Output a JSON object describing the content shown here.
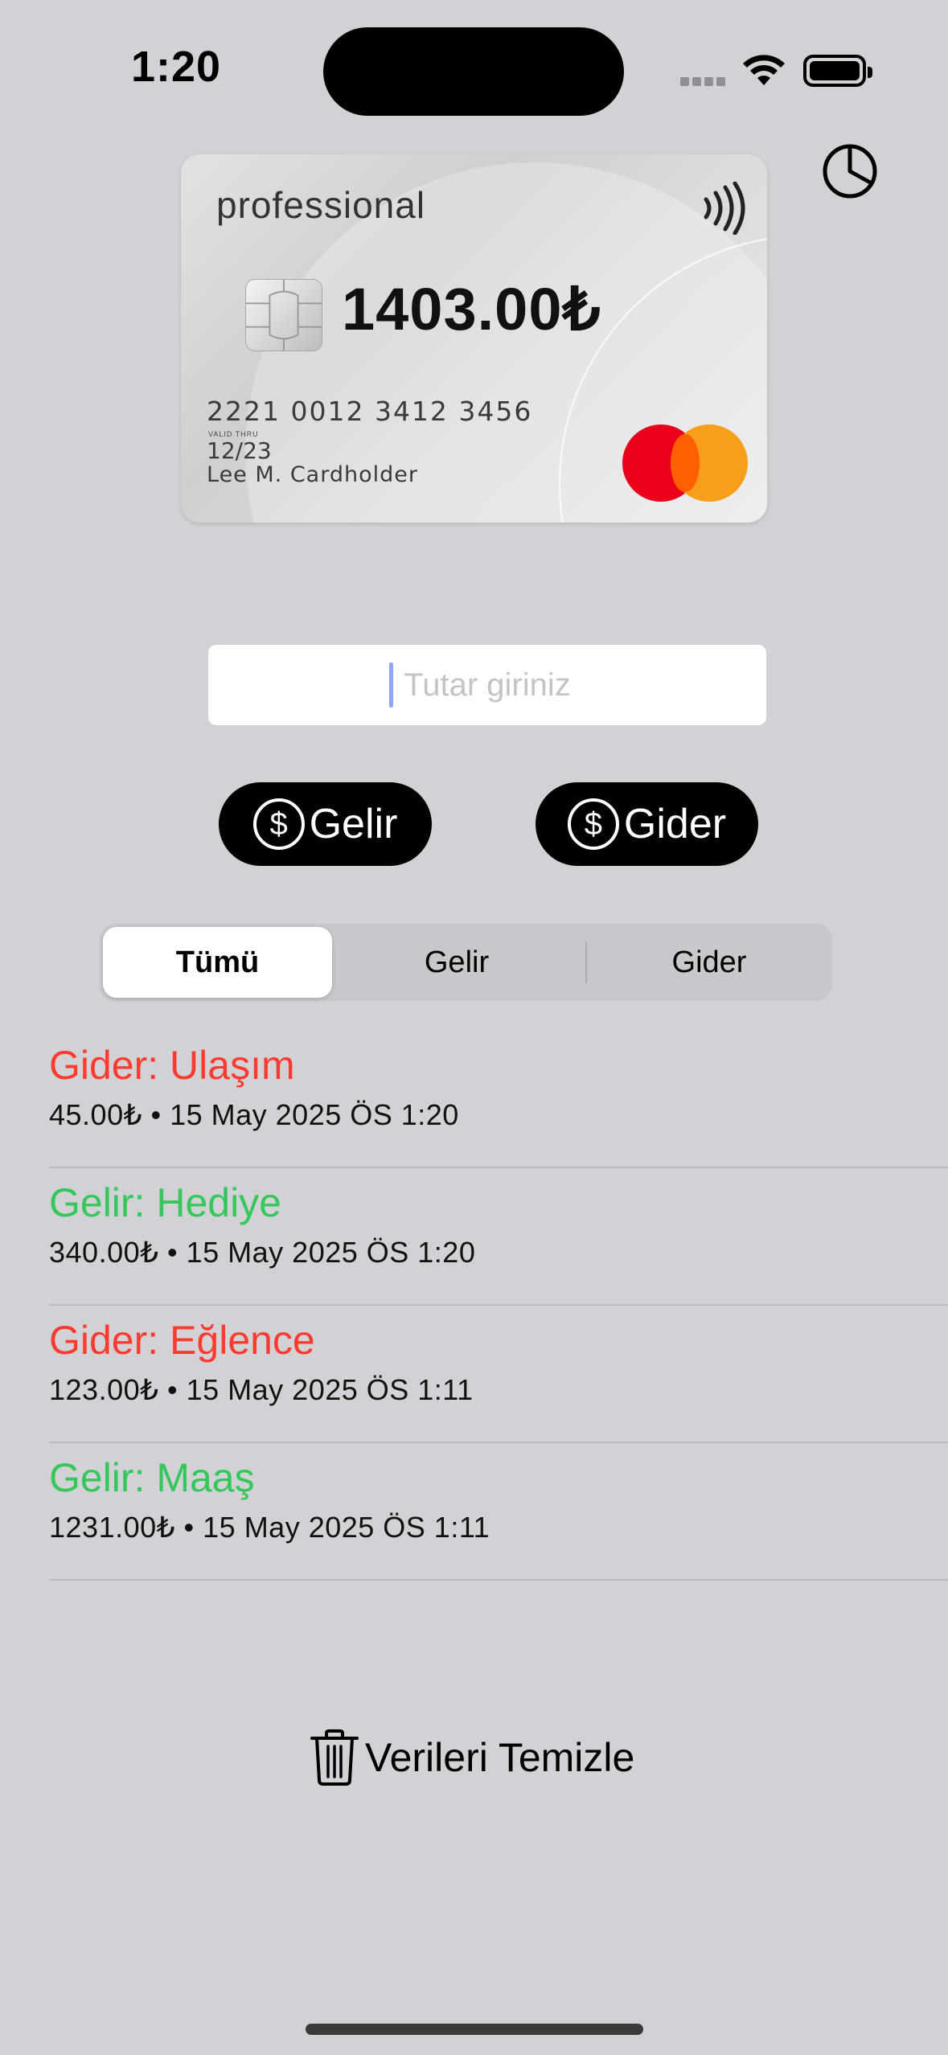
{
  "status_bar": {
    "time": "1:20"
  },
  "card": {
    "brand": "professional",
    "balance": "1403.00₺",
    "number": "2221 0012 3412 3456",
    "valid_thru_label": "VALID THRU",
    "valid_thru": "12/23",
    "holder": "Lee M. Cardholder",
    "network_icon": "mastercard-logo",
    "colors": {
      "mc_red": "#eb001b",
      "mc_orange": "#f79e1b"
    }
  },
  "amount_input": {
    "placeholder": "Tutar giriniz",
    "value": ""
  },
  "actions": {
    "income_label": "Gelir",
    "expense_label": "Gider",
    "icon": "dollar-circle-icon"
  },
  "filter": {
    "selected": "Tümü",
    "segments": [
      "Tümü",
      "Gelir",
      "Gider"
    ]
  },
  "transactions": [
    {
      "title": "Gider: Ulaşım",
      "subtitle": "45.00₺ • 15 May 2025 ÖS 1:20",
      "type": "expense"
    },
    {
      "title": "Gelir: Hediye",
      "subtitle": "340.00₺ • 15 May 2025 ÖS 1:20",
      "type": "income"
    },
    {
      "title": "Gider: Eğlence",
      "subtitle": "123.00₺ • 15 May 2025 ÖS 1:11",
      "type": "expense"
    },
    {
      "title": "Gelir: Maaş",
      "subtitle": "1231.00₺ • 15 May 2025 ÖS 1:11",
      "type": "income"
    }
  ],
  "clear_button": {
    "label": "Verileri Temizle",
    "icon": "trash-icon"
  },
  "colors": {
    "background": "#d1d1d6",
    "expense": "#ff3b30",
    "income": "#34c759"
  }
}
